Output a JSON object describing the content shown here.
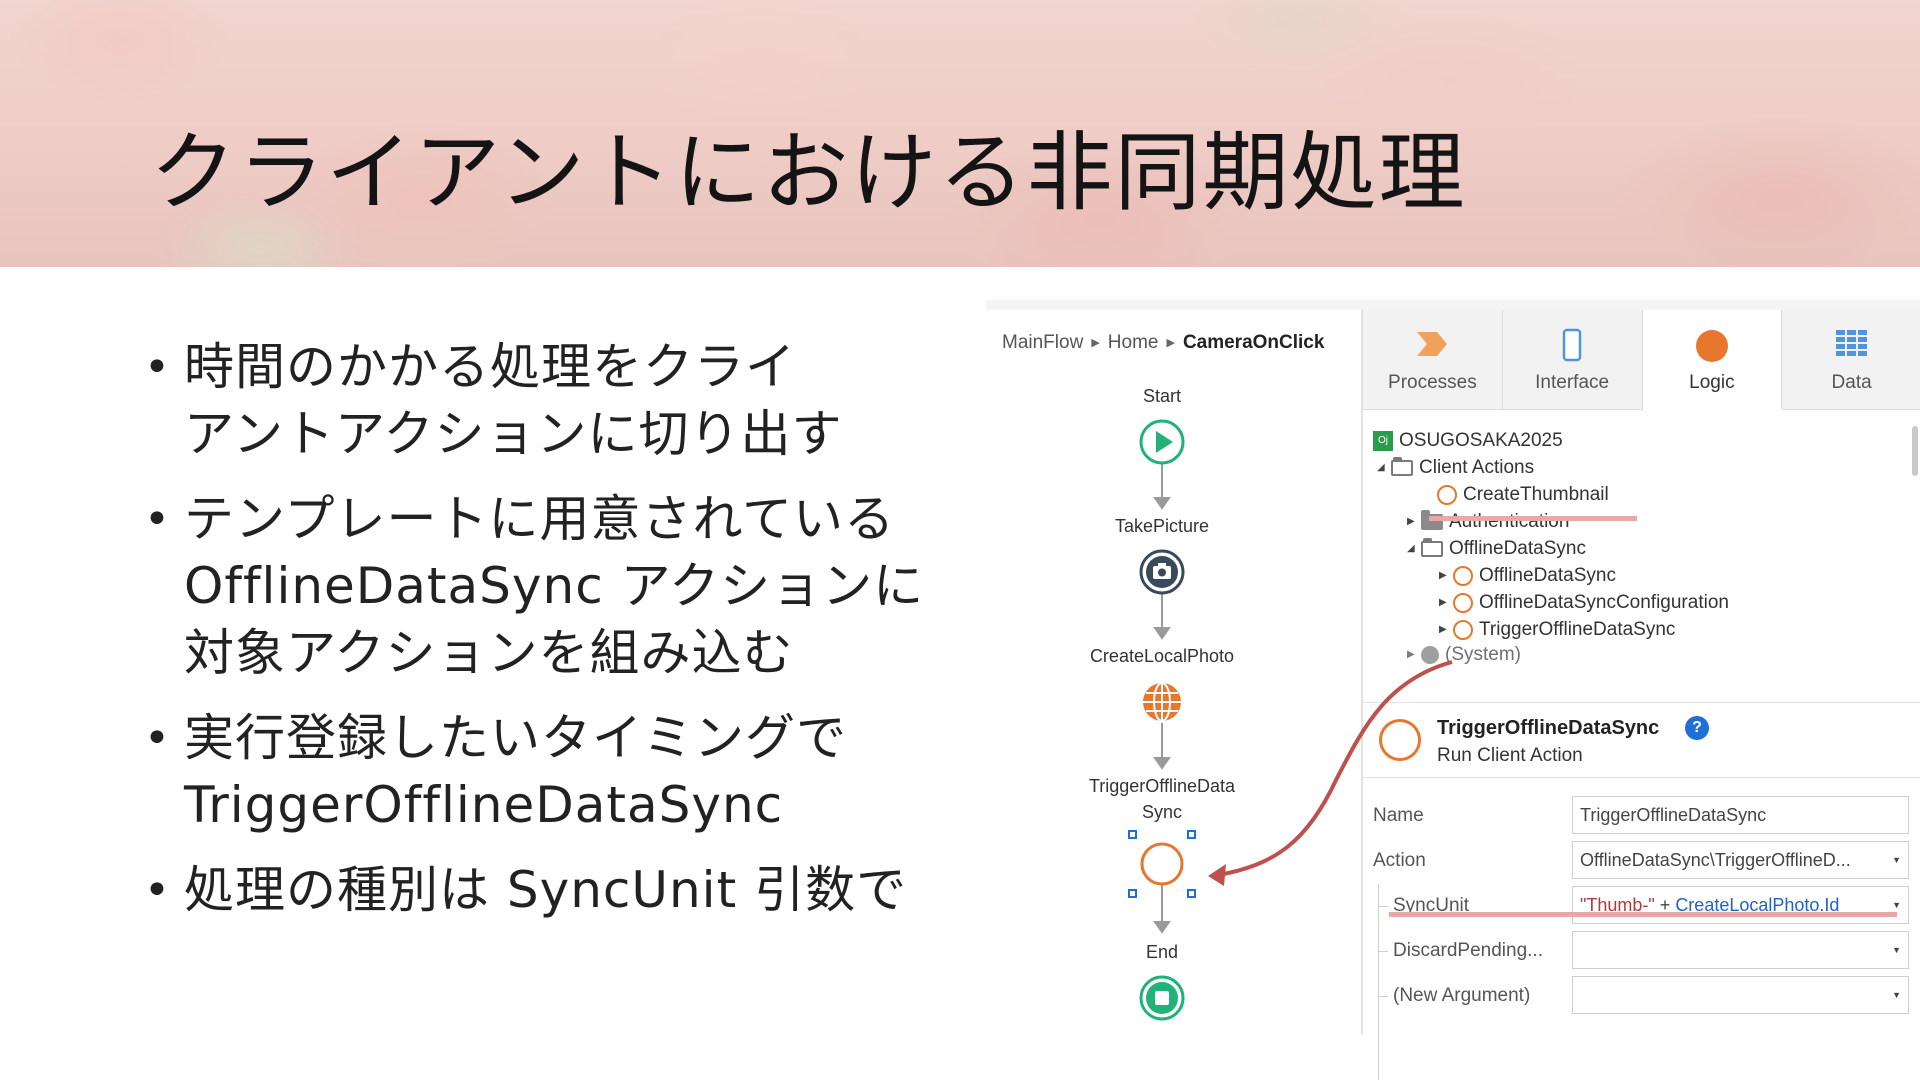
{
  "slide": {
    "title": "クライアントにおける非同期処理",
    "bullets": [
      [
        "時間のかかる処理をクライ",
        "アントアクションに切り出す"
      ],
      [
        "テンプレートに用意されている",
        "OfflineDataSync アクションに",
        "対象アクションを組み込む"
      ],
      [
        "実行登録したいタイミングで",
        "TriggerOfflineDataSync"
      ],
      [
        "処理の種別は SyncUnit 引数で"
      ]
    ]
  },
  "flow": {
    "breadcrumb": [
      "MainFlow",
      "Home",
      "CameraOnClick"
    ],
    "nodes": {
      "start": "Start",
      "take_picture": "TakePicture",
      "create_local_photo": "CreateLocalPhoto",
      "trigger_line1": "TriggerOfflineData",
      "trigger_line2": "Sync",
      "end": "End"
    },
    "colors": {
      "start_end": "#1fb37a",
      "camera": "#3a4a5a",
      "aggregate": "#e8772e",
      "client_action": "#e8772e",
      "selection": "#1e6fd6"
    }
  },
  "sidebar": {
    "tabs": [
      {
        "label": "Processes",
        "icon": "processes-icon"
      },
      {
        "label": "Interface",
        "icon": "interface-icon"
      },
      {
        "label": "Logic",
        "icon": "logic-icon"
      },
      {
        "label": "Data",
        "icon": "data-icon"
      }
    ],
    "active_tab": "Logic",
    "tree": {
      "module": "OSUGOSAKA2025",
      "module_badge": "Oj",
      "client_actions": "Client Actions",
      "create_thumbnail": "CreateThumbnail",
      "authentication": "Authentication",
      "offline_folder": "OfflineDataSync",
      "offline_action": "OfflineDataSync",
      "offline_config": "OfflineDataSyncConfiguration",
      "trigger": "TriggerOfflineDataSync",
      "system": "(System)"
    },
    "props": {
      "title": "TriggerOfflineDataSync",
      "subtitle": "Run Client Action",
      "help": "?",
      "rows": {
        "name_label": "Name",
        "name_value": "TriggerOfflineDataSync",
        "action_label": "Action",
        "action_value": "OfflineDataSync\\TriggerOfflineD...",
        "syncunit_label": "SyncUnit",
        "syncunit_str": "\"Thumb-\"",
        "syncunit_op": " + ",
        "syncunit_ref": "CreateLocalPhoto.Id",
        "discard_label": "DiscardPending...",
        "newarg_label": "(New Argument)"
      }
    },
    "highlight_color": "#e9a8a8",
    "arrow_color": "#c0504d"
  }
}
